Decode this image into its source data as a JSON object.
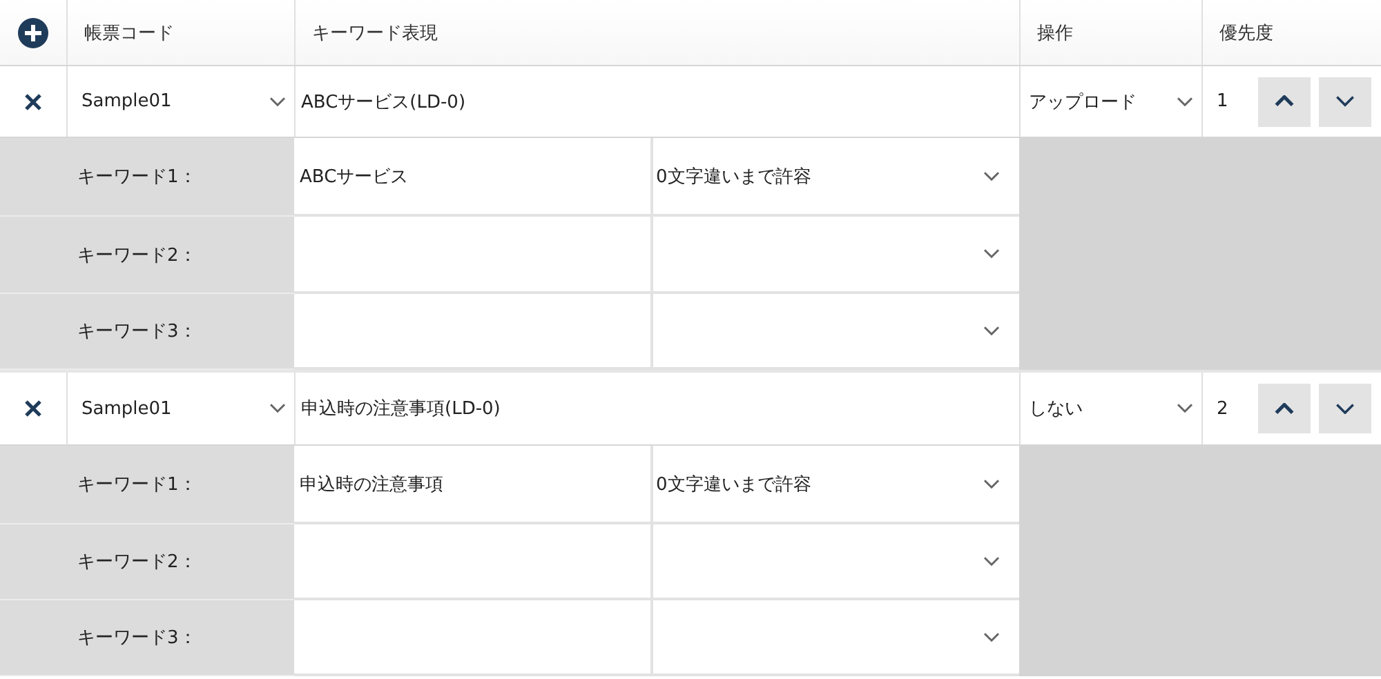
{
  "header": {
    "columns": [
      "帳票コード",
      "キーワード表現",
      "操作",
      "優先度"
    ]
  },
  "groups": [
    {
      "code": "Sample01",
      "expression": "ABCサービス(LD-0)",
      "operation": "アップロード",
      "priority": "1",
      "keywords": [
        {
          "label": "キーワード1：",
          "value": "ABCサービス",
          "tolerance": "0文字違いまで許容"
        },
        {
          "label": "キーワード2："
        },
        {
          "label": "キーワード3："
        }
      ]
    },
    {
      "code": "Sample01",
      "expression": "申込時の注意事項(LD-0)",
      "operation": "しない",
      "priority": "2",
      "keywords": [
        {
          "label": "キーワード1：",
          "value": "申込時の注意事項",
          "tolerance": "0文字違いまで許容"
        },
        {
          "label": "キーワード2："
        },
        {
          "label": "キーワード3："
        }
      ]
    }
  ]
}
